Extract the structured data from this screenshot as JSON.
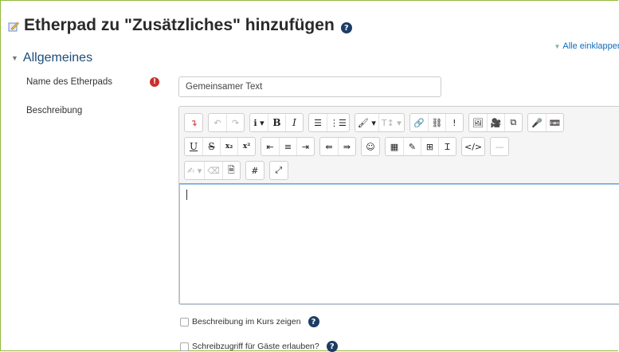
{
  "page": {
    "title": "Etherpad zu \"Zusätzliches\" hinzufügen",
    "help_glyph": "?",
    "collapse_all": "Alle einklappen"
  },
  "section": {
    "title": "Allgemeines"
  },
  "form": {
    "name_label": "Name des Etherpads",
    "required_glyph": "!",
    "name_value": "Gemeinsamer Text",
    "description_label": "Beschreibung",
    "show_description_label": "Beschreibung im Kurs zeigen",
    "guest_write_label": "Schreibzugriff für Gäste erlauben?"
  },
  "toolbar": {
    "row1": [
      [
        "↴"
      ],
      [
        "↶",
        "↷"
      ],
      [
        "ℹ ▾",
        "B",
        "I"
      ],
      [
        "☰",
        "⋮☰"
      ],
      [
        "🖌 ▾",
        "T↕ ▾"
      ],
      [
        "🔗",
        "⛓",
        "!"
      ],
      [
        "🖼",
        "🎥",
        "⧉"
      ],
      [
        "🎤",
        "📼"
      ]
    ],
    "row2": [
      [
        "U",
        "S",
        "x₂",
        "x²"
      ],
      [
        "⇤",
        "≡",
        "⇥"
      ],
      [
        "⇚",
        "⇛"
      ],
      [
        "☺"
      ],
      [
        "▦",
        "✎",
        "⊞",
        "Ɪ"
      ],
      [
        "</>"
      ],
      [
        "—"
      ]
    ],
    "row3": [
      [
        "✍ ▾",
        "⌫",
        "🗎"
      ],
      [
        "#"
      ],
      [
        "⤢"
      ]
    ]
  },
  "colors": {
    "accent": "#0f6cbf",
    "section_title": "#1d4b7a",
    "required": "#c9302c",
    "help_badge": "#1d3c66",
    "frame": "#8fb83a"
  }
}
